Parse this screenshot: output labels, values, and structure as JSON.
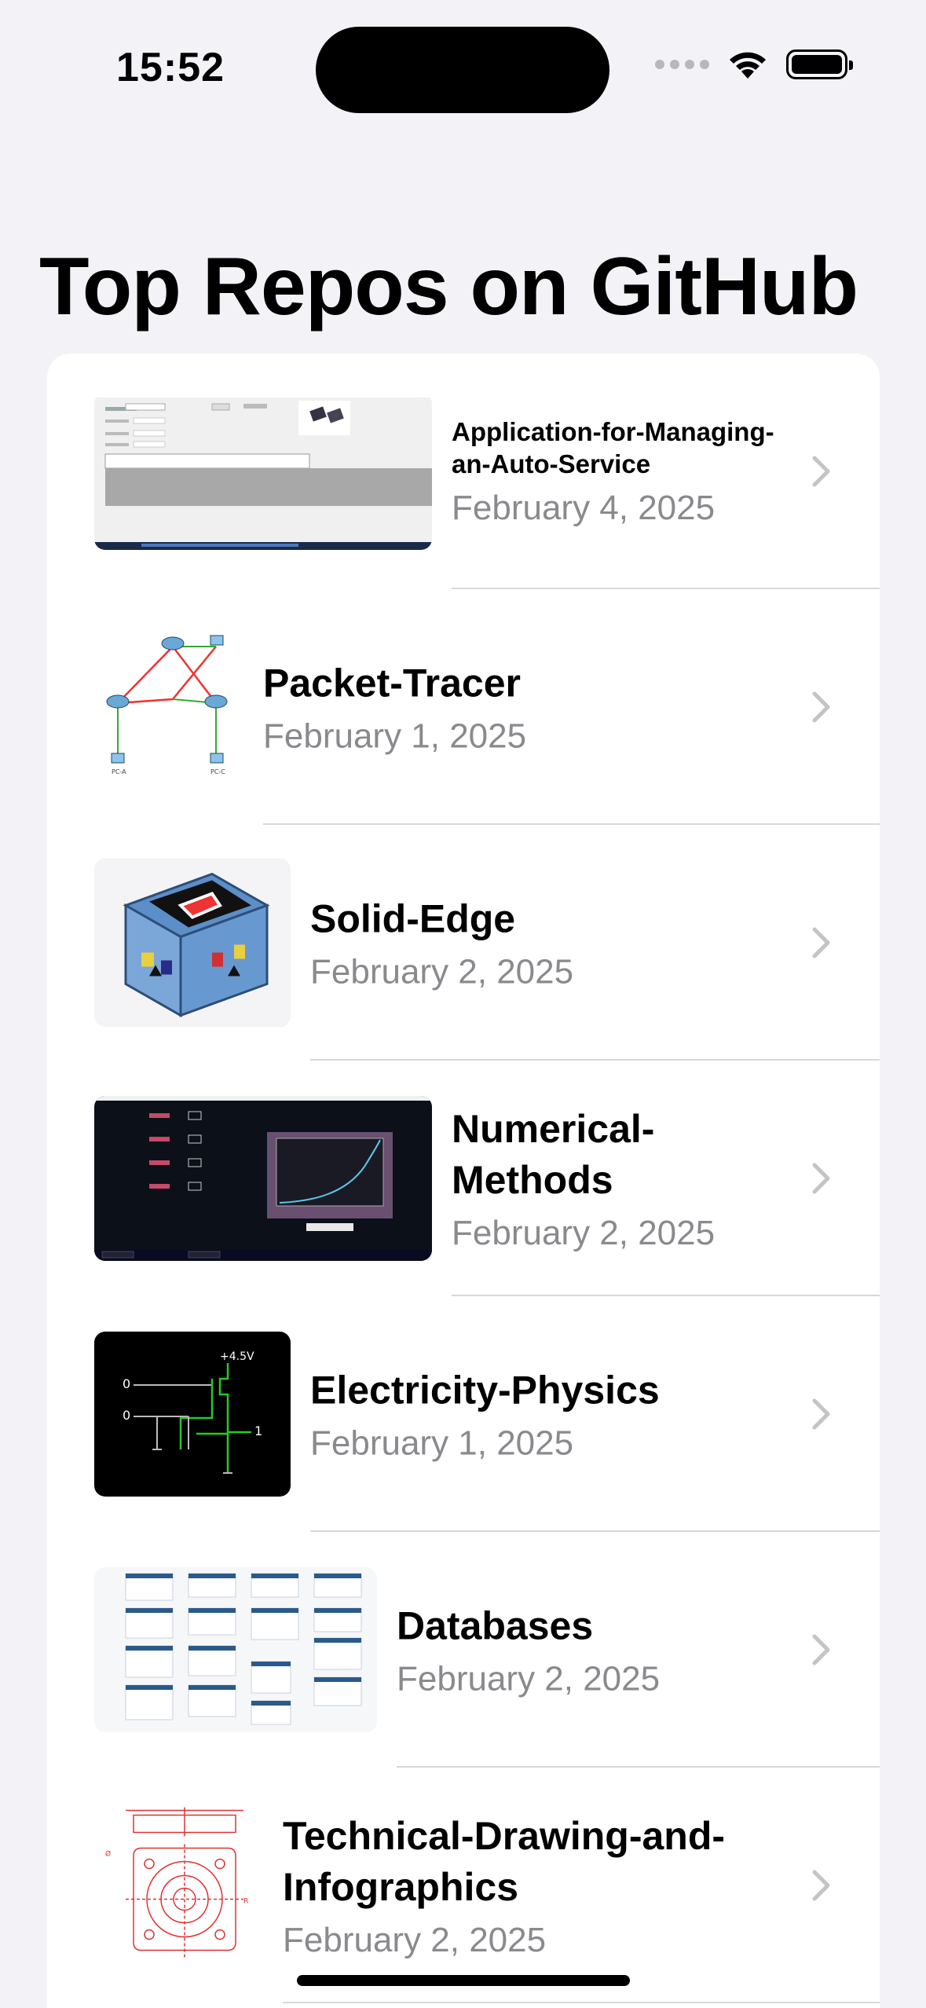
{
  "status": {
    "time": "15:52"
  },
  "title": "Top Repos on GitHub",
  "repos": [
    {
      "name": "Application-for-Managing-an-Auto-Service",
      "date": "February 4, 2025"
    },
    {
      "name": "Packet-Tracer",
      "date": "February 1, 2025"
    },
    {
      "name": "Solid-Edge",
      "date": "February 2, 2025"
    },
    {
      "name": "Numerical-Methods",
      "date": "February 2, 2025"
    },
    {
      "name": "Electricity-Physics",
      "date": "February 1, 2025"
    },
    {
      "name": "Databases",
      "date": "February 2, 2025"
    },
    {
      "name": "Technical-Drawing-and-Infographics",
      "date": "February 2, 2025"
    }
  ],
  "colors": {
    "background": "#f2f2f7",
    "secondary_text": "#8a8a8e",
    "chevron": "#c4c4c7"
  },
  "icons": {
    "wifi": "wifi-icon",
    "battery": "battery-icon",
    "chevron": "chevron-right-icon"
  }
}
